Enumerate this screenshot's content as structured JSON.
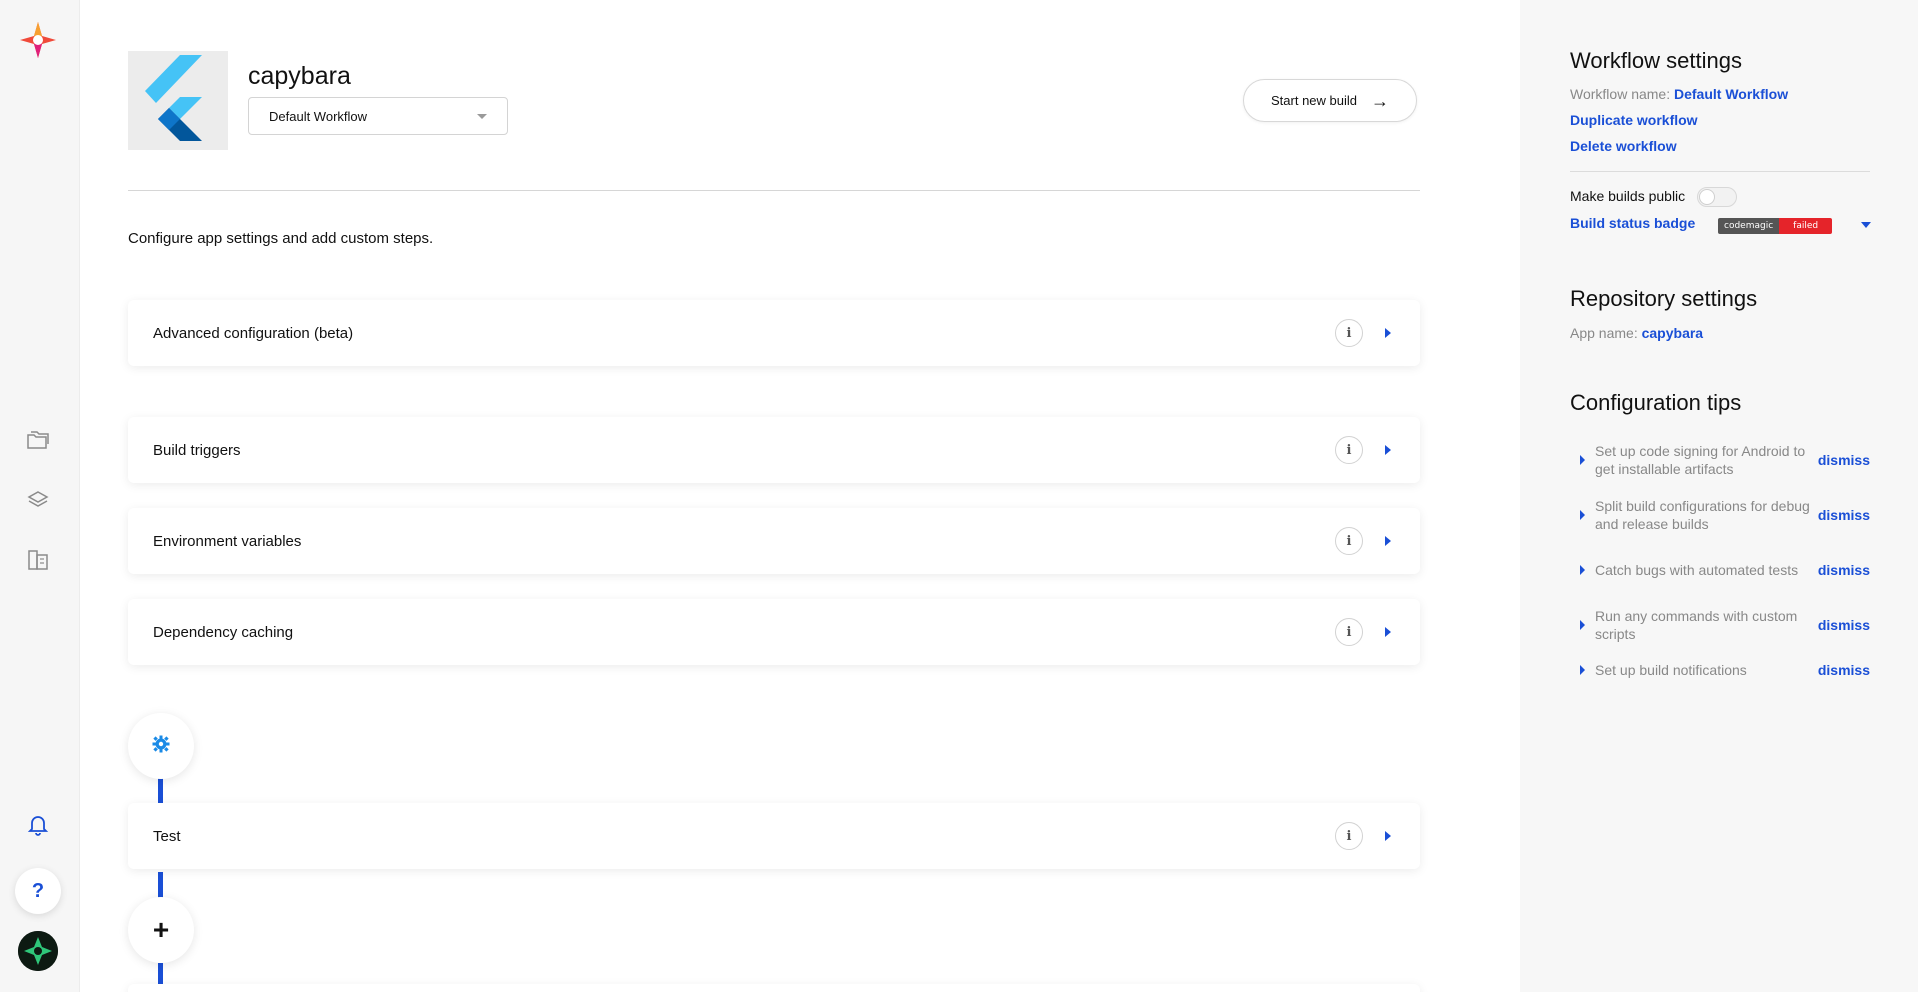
{
  "app": {
    "name": "capybara",
    "workflow_selected": "Default Workflow",
    "start_build_label": "Start new build",
    "intro": "Configure app settings and add custom steps."
  },
  "sections": [
    {
      "label": "Advanced configuration (beta)"
    },
    {
      "label": "Build triggers"
    },
    {
      "label": "Environment variables"
    },
    {
      "label": "Dependency caching"
    },
    {
      "label": "Test"
    }
  ],
  "sidebar": {
    "workflow_settings": {
      "title": "Workflow settings",
      "name_label": "Workflow name:",
      "name_value": "Default Workflow",
      "duplicate": "Duplicate workflow",
      "delete": "Delete workflow",
      "make_public": "Make builds public",
      "make_public_on": false,
      "status_badge": "Build status badge",
      "badge_left": "codemagic",
      "badge_right": "failed"
    },
    "repository_settings": {
      "title": "Repository settings",
      "app_name_label": "App name:",
      "app_name_value": "capybara"
    },
    "tips": {
      "title": "Configuration tips",
      "dismiss_label": "dismiss",
      "items": [
        {
          "text": "Set up code signing for Android to get installable artifacts"
        },
        {
          "text": "Split build configurations for debug and release builds"
        },
        {
          "text": "Catch bugs with automated tests"
        },
        {
          "text": "Run any commands with custom scripts"
        },
        {
          "text": "Set up build notifications"
        }
      ]
    }
  },
  "nav": {
    "icons": [
      "codemagic-logo-icon",
      "folder-icon",
      "layers-icon",
      "book-icon",
      "bell-icon",
      "help-icon",
      "avatar"
    ],
    "help_glyph": "?"
  },
  "colors": {
    "accent": "#1a4fd6",
    "brand_red": "#e5242a",
    "muted_text": "#888888"
  }
}
